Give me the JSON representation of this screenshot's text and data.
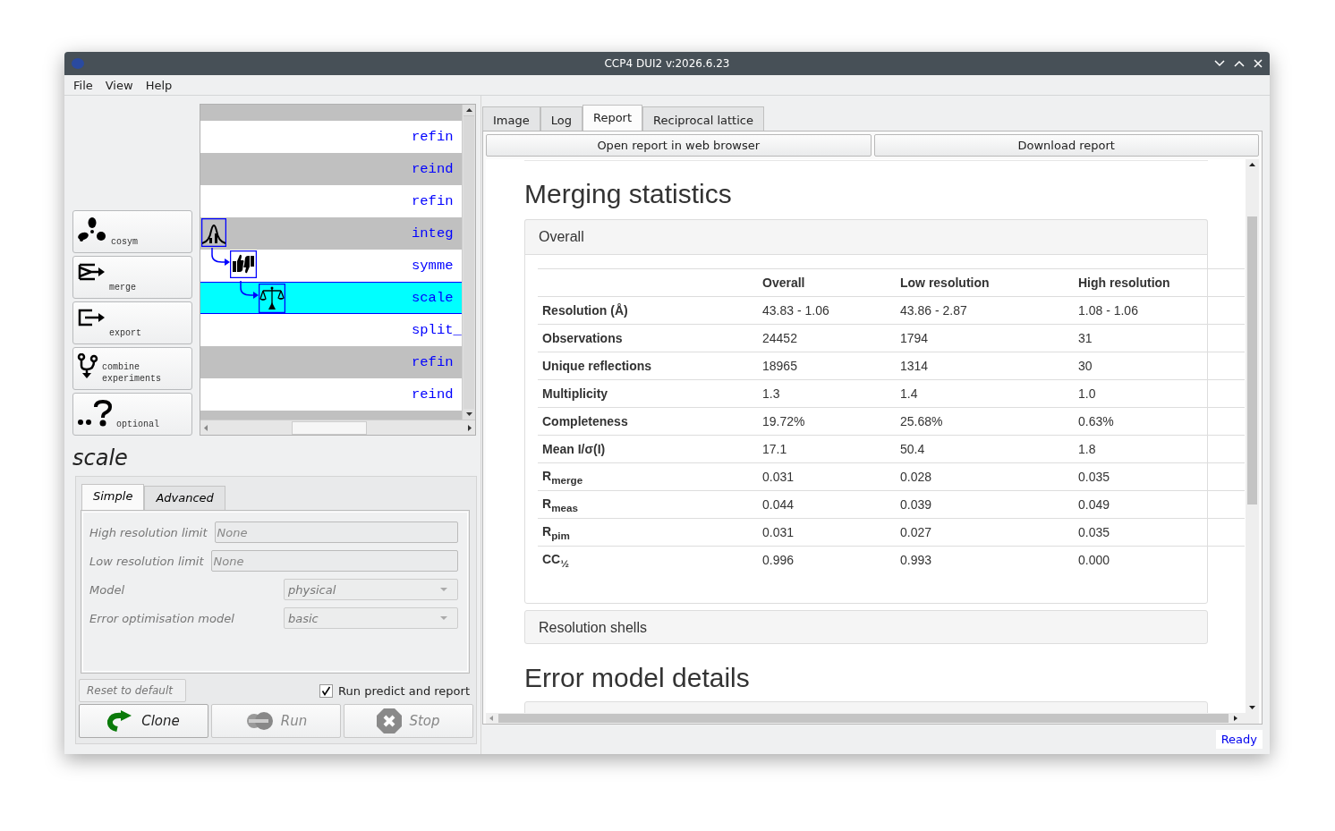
{
  "window": {
    "title": "CCP4 DUI2 v:2026.6.23"
  },
  "menu": [
    "File",
    "View",
    "Help"
  ],
  "tools": [
    {
      "kind": "cosym",
      "label": "cosym"
    },
    {
      "kind": "merge",
      "label": "merge"
    },
    {
      "kind": "export",
      "label": "export"
    },
    {
      "kind": "combine",
      "label": "combine experiments"
    },
    {
      "kind": "optional",
      "label": "optional"
    }
  ],
  "tree": {
    "rows": [
      {
        "label": "refin",
        "selected": false
      },
      {
        "label": "reind",
        "selected": false
      },
      {
        "label": "refin",
        "selected": false
      },
      {
        "label": "integ",
        "selected": false,
        "kind": "integrate",
        "children": [
          {
            "label": "symme",
            "selected": false,
            "kind": "symmetry",
            "children": [
              {
                "label": "scale",
                "selected": true,
                "kind": "scale"
              }
            ]
          }
        ]
      },
      {
        "label": "split_",
        "selected": false
      },
      {
        "label": "refin",
        "selected": false
      },
      {
        "label": "reind",
        "selected": false
      }
    ]
  },
  "step": {
    "title": "scale",
    "tabs": [
      {
        "label": "Simple",
        "selected": true
      },
      {
        "label": "Advanced",
        "selected": false
      }
    ],
    "fields": [
      {
        "kind": "text",
        "label": "High resolution limit",
        "placeholder": "None"
      },
      {
        "kind": "text",
        "label": "Low resolution limit",
        "placeholder": "None"
      },
      {
        "kind": "select",
        "label": "Model",
        "value": "physical"
      },
      {
        "kind": "select",
        "label": "Error optimisation model",
        "value": "basic"
      }
    ],
    "reset_button": "Reset to default",
    "run_predict": {
      "label": "Run predict and report",
      "checked": true
    },
    "actions": [
      {
        "kind": "clone",
        "label": "Clone",
        "disabled": false
      },
      {
        "kind": "run",
        "label": "Run",
        "disabled": true
      },
      {
        "kind": "stop",
        "label": "Stop",
        "disabled": true
      }
    ]
  },
  "tabs": [
    {
      "label": "Image",
      "selected": false
    },
    {
      "label": "Log",
      "selected": false
    },
    {
      "label": "Report",
      "selected": true
    },
    {
      "label": "Reciprocal lattice",
      "selected": false
    }
  ],
  "report_buttons": [
    "Open report in web browser",
    "Download report"
  ],
  "report": {
    "heading": "Merging statistics",
    "overall": {
      "title": "Overall",
      "columns": [
        "Overall",
        "Low resolution",
        "High resolution"
      ],
      "rows": [
        {
          "label": "Resolution (Å)",
          "values": [
            "43.83 - 1.06",
            "43.86 - 2.87",
            "1.08 - 1.06"
          ]
        },
        {
          "label": "Observations",
          "values": [
            "24452",
            "1794",
            "31"
          ]
        },
        {
          "label": "Unique reflections",
          "values": [
            "18965",
            "1314",
            "30"
          ]
        },
        {
          "label": "Multiplicity",
          "values": [
            "1.3",
            "1.4",
            "1.0"
          ]
        },
        {
          "label": "Completeness",
          "values": [
            "19.72%",
            "25.68%",
            "0.63%"
          ]
        },
        {
          "label": "Mean I/σ(I)",
          "values": [
            "17.1",
            "50.4",
            "1.8"
          ]
        },
        {
          "label": "R$_{merge}$",
          "values": [
            "0.031",
            "0.028",
            "0.035"
          ]
        },
        {
          "label": "R$_{meas}$",
          "values": [
            "0.044",
            "0.039",
            "0.049"
          ]
        },
        {
          "label": "R$_{pim}$",
          "values": [
            "0.031",
            "0.027",
            "0.035"
          ]
        },
        {
          "label": "CC$_{½}$",
          "values": [
            "0.996",
            "0.993",
            "0.000"
          ]
        }
      ]
    },
    "shells_title": "Resolution shells",
    "heading2": "Error model details"
  },
  "status": "Ready"
}
